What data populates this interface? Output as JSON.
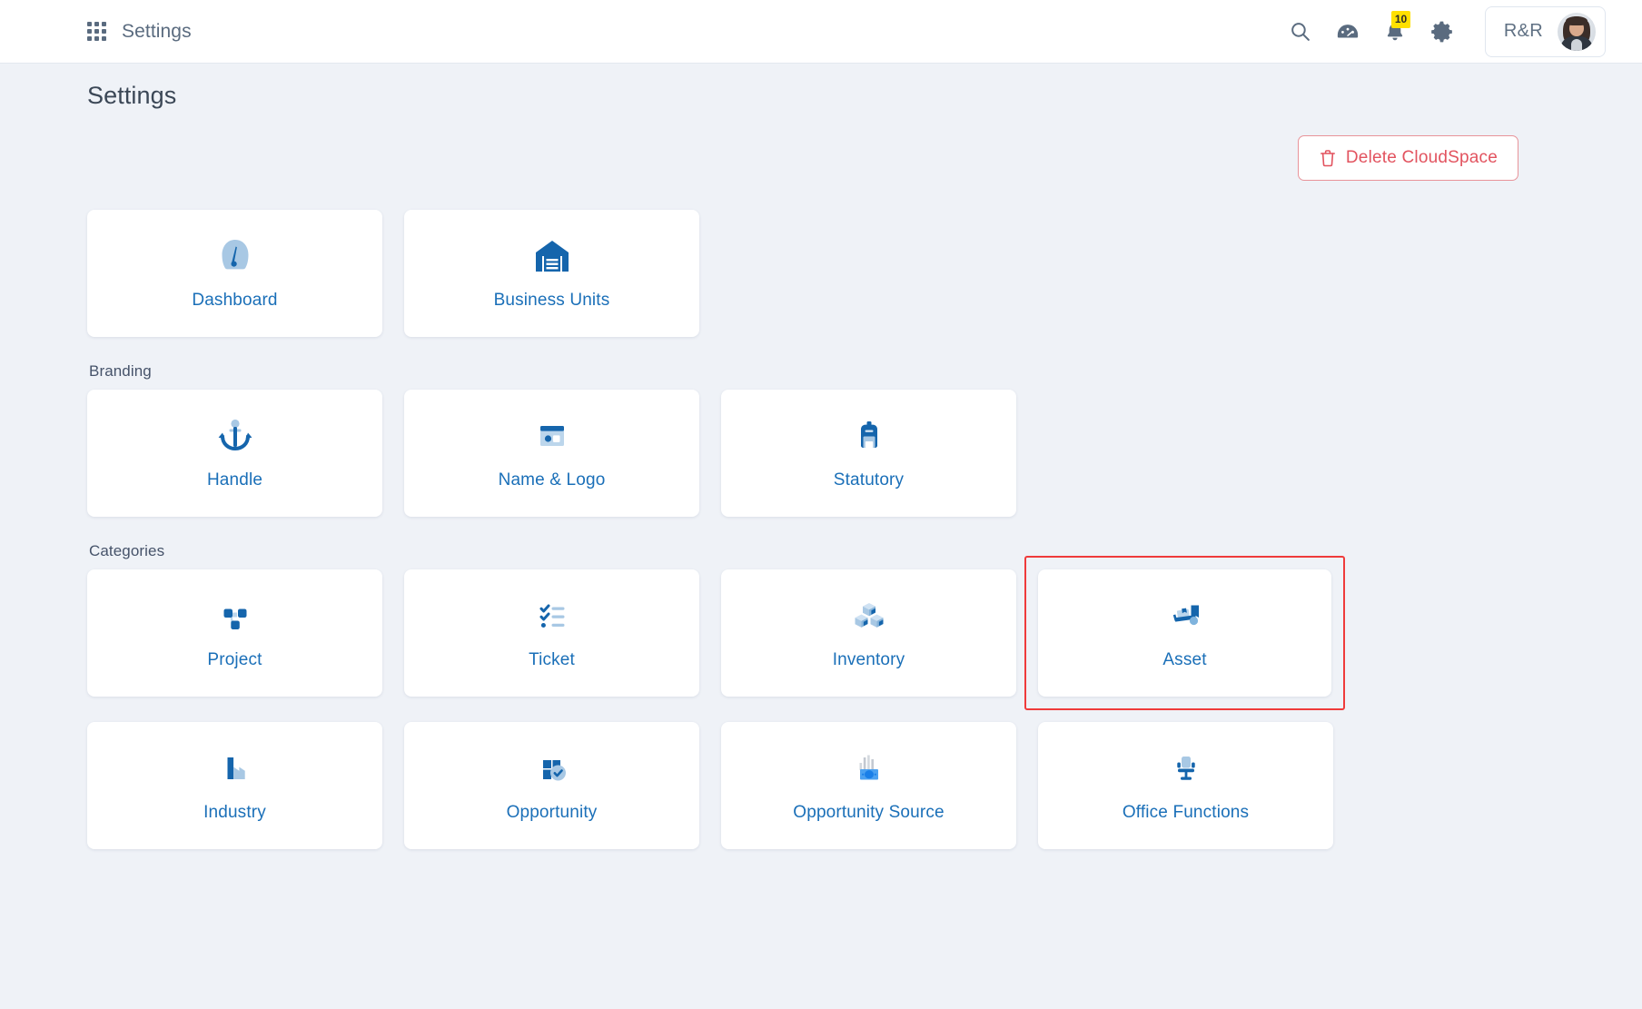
{
  "topbar": {
    "app_label": "Settings",
    "grid_icon": "apps-grid-icon",
    "icons": [
      {
        "name": "search-icon",
        "label": "Search"
      },
      {
        "name": "speedometer-icon",
        "label": "Performance"
      },
      {
        "name": "bell-icon",
        "label": "Notifications",
        "badge": "10"
      },
      {
        "name": "gear-icon",
        "label": "Settings"
      }
    ],
    "user": {
      "name": "R&R",
      "avatar_name": "user-avatar"
    }
  },
  "page": {
    "title": "Settings"
  },
  "toolbar": {
    "delete_label": "Delete CloudSpace",
    "delete_icon": "trash-icon",
    "delete_color": "#e2535f"
  },
  "sections": [
    {
      "label": "",
      "cards": [
        {
          "label": "Dashboard",
          "icon": "gauge-icon",
          "highlighted": false
        },
        {
          "label": "Business Units",
          "icon": "warehouse-icon",
          "highlighted": false
        }
      ]
    },
    {
      "label": "Branding",
      "cards": [
        {
          "label": "Handle",
          "icon": "anchor-icon",
          "highlighted": false
        },
        {
          "label": "Name & Logo",
          "icon": "browser-window-icon",
          "highlighted": false
        },
        {
          "label": "Statutory",
          "icon": "backpack-icon",
          "highlighted": false
        }
      ]
    },
    {
      "label": "Categories",
      "cards": [
        {
          "label": "Project",
          "icon": "sitemap-icon",
          "highlighted": false
        },
        {
          "label": "Ticket",
          "icon": "checklist-icon",
          "highlighted": false
        },
        {
          "label": "Inventory",
          "icon": "cubes-icon",
          "highlighted": false
        },
        {
          "label": "Asset",
          "icon": "dolly-box-icon",
          "highlighted": true
        }
      ]
    },
    {
      "label": "",
      "cards": [
        {
          "label": "Industry",
          "icon": "factory-icon",
          "highlighted": false
        },
        {
          "label": "Opportunity",
          "icon": "briefcase-check-icon",
          "highlighted": false
        },
        {
          "label": "Opportunity Source",
          "icon": "money-chart-icon",
          "highlighted": false
        },
        {
          "label": "Office Functions",
          "icon": "office-chair-icon",
          "highlighted": false
        }
      ]
    }
  ],
  "colors": {
    "page_bg": "#eff2f7",
    "card_bg": "#ffffff",
    "link_blue": "#1a6fb8",
    "icon_dark_blue": "#1565ac",
    "icon_light_blue": "#a8c8e4",
    "highlight_red": "#ef3b3b",
    "badge_yellow": "#ffe000"
  }
}
